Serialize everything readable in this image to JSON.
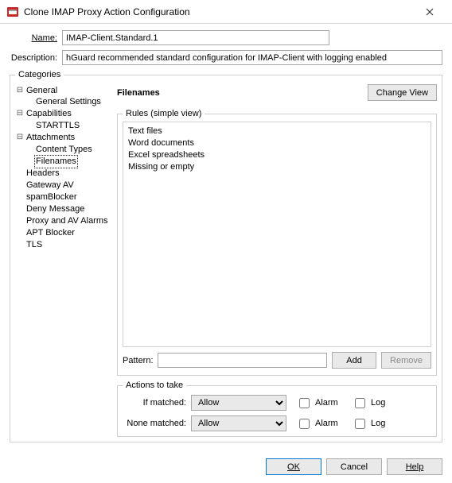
{
  "titlebar": {
    "title": "Clone IMAP Proxy Action Configuration"
  },
  "form": {
    "name_label": "Name:",
    "name_value": "IMAP-Client.Standard.1",
    "desc_label": "Description:",
    "desc_value": "hGuard recommended standard configuration for IMAP-Client with logging enabled"
  },
  "categories": {
    "legend": "Categories",
    "nodes": {
      "general": "General",
      "general_settings": "General Settings",
      "capabilities": "Capabilities",
      "starttls": "STARTTLS",
      "attachments": "Attachments",
      "content_types": "Content Types",
      "filenames": "Filenames",
      "headers": "Headers",
      "gateway_av": "Gateway AV",
      "spamblocker": "spamBlocker",
      "deny_message": "Deny Message",
      "proxy_av_alarms": "Proxy and AV Alarms",
      "apt_blocker": "APT Blocker",
      "tls": "TLS"
    }
  },
  "right": {
    "heading": "Filenames",
    "change_view": "Change View",
    "rules_legend": "Rules (simple view)",
    "rules": {
      "r0": "Text files",
      "r1": "Word documents",
      "r2": "Excel spreadsheets",
      "r3": "Missing or empty"
    },
    "pattern_label": "Pattern:",
    "add": "Add",
    "remove": "Remove"
  },
  "actions": {
    "legend": "Actions to take",
    "if_matched_label": "If matched:",
    "none_matched_label": "None matched:",
    "allow": "Allow",
    "alarm": "Alarm",
    "log": "Log"
  },
  "buttons": {
    "ok": "OK",
    "cancel": "Cancel",
    "help": "Help"
  }
}
